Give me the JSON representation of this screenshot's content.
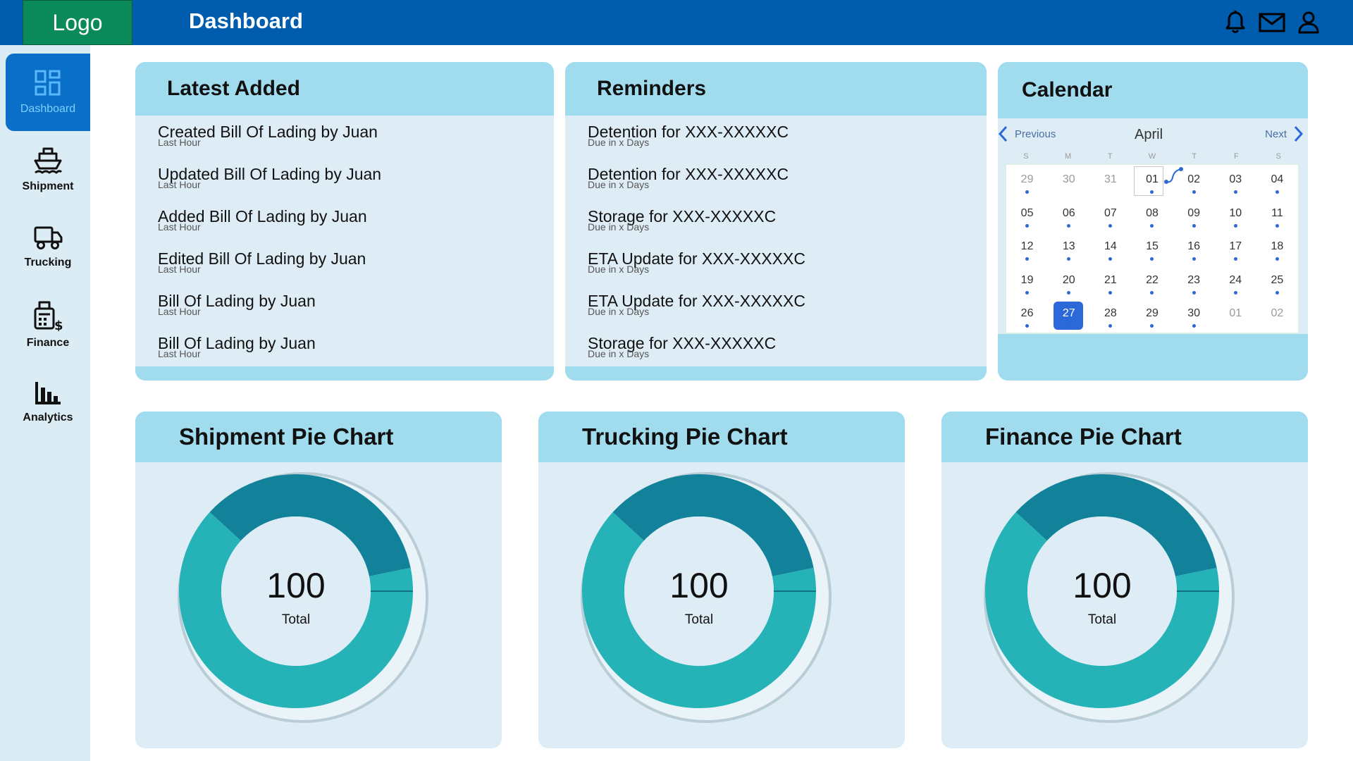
{
  "header": {
    "logo": "Logo",
    "title": "Dashboard",
    "icons": [
      "bell-icon",
      "mail-icon",
      "user-icon"
    ]
  },
  "sidebar": {
    "items": [
      {
        "label": "Dashboard",
        "icon": "dashboard-icon",
        "active": true
      },
      {
        "label": "Shipment",
        "icon": "ship-icon",
        "active": false
      },
      {
        "label": "Trucking",
        "icon": "truck-icon",
        "active": false
      },
      {
        "label": "Finance",
        "icon": "finance-icon",
        "active": false
      },
      {
        "label": "Analytics",
        "icon": "bar-chart-icon",
        "active": false
      }
    ]
  },
  "latest": {
    "title": "Latest Added",
    "items": [
      {
        "text": "Created Bill Of Lading by Juan",
        "sub": "Last Hour"
      },
      {
        "text": "Updated Bill Of Lading by Juan",
        "sub": "Last Hour"
      },
      {
        "text": "Added Bill Of Lading by Juan",
        "sub": "Last Hour"
      },
      {
        "text": "Edited Bill Of Lading by Juan",
        "sub": "Last Hour"
      },
      {
        "text": "Bill Of Lading by Juan",
        "sub": "Last Hour"
      },
      {
        "text": "Bill Of Lading by Juan",
        "sub": "Last Hour"
      }
    ]
  },
  "reminders": {
    "title": "Reminders",
    "items": [
      {
        "text": "Detention for XXX-XXXXXC",
        "sub": "Due in x Days"
      },
      {
        "text": "Detention for XXX-XXXXXC",
        "sub": "Due in x Days"
      },
      {
        "text": "Storage for XXX-XXXXXC",
        "sub": "Due in x Days"
      },
      {
        "text": "ETA Update for XXX-XXXXXC",
        "sub": "Due in x Days"
      },
      {
        "text": "ETA Update for XXX-XXXXXC",
        "sub": "Due in x Days"
      },
      {
        "text": "Storage for XXX-XXXXXC",
        "sub": "Due in x Days"
      }
    ]
  },
  "calendar": {
    "title": "Calendar",
    "prev_label": "Previous",
    "next_label": "Next",
    "month": "April",
    "weekdays": [
      "S",
      "M",
      "T",
      "W",
      "T",
      "F",
      "S"
    ],
    "days": [
      {
        "d": "29",
        "other": true,
        "dot": true
      },
      {
        "d": "30",
        "other": true,
        "dot": false
      },
      {
        "d": "31",
        "other": true,
        "dot": false
      },
      {
        "d": "01",
        "today": true,
        "dot": true
      },
      {
        "d": "02",
        "dot": true
      },
      {
        "d": "03",
        "dot": true
      },
      {
        "d": "04",
        "dot": true
      },
      {
        "d": "05",
        "dot": true
      },
      {
        "d": "06",
        "dot": true
      },
      {
        "d": "07",
        "dot": true
      },
      {
        "d": "08",
        "dot": true
      },
      {
        "d": "09",
        "dot": true
      },
      {
        "d": "10",
        "dot": true
      },
      {
        "d": "11",
        "dot": true
      },
      {
        "d": "12",
        "dot": true
      },
      {
        "d": "13",
        "dot": true
      },
      {
        "d": "14",
        "dot": true
      },
      {
        "d": "15",
        "dot": true
      },
      {
        "d": "16",
        "dot": true
      },
      {
        "d": "17",
        "dot": true
      },
      {
        "d": "18",
        "dot": true
      },
      {
        "d": "19",
        "dot": true
      },
      {
        "d": "20",
        "dot": true
      },
      {
        "d": "21",
        "dot": true
      },
      {
        "d": "22",
        "dot": true
      },
      {
        "d": "23",
        "dot": true
      },
      {
        "d": "24",
        "dot": true
      },
      {
        "d": "25",
        "dot": true
      },
      {
        "d": "26",
        "dot": true
      },
      {
        "d": "27",
        "selected": true,
        "dot": true
      },
      {
        "d": "28",
        "dot": true
      },
      {
        "d": "29",
        "dot": true
      },
      {
        "d": "30",
        "dot": true
      },
      {
        "d": "01",
        "other": true,
        "dot": false
      },
      {
        "d": "02",
        "other": true,
        "dot": false
      }
    ]
  },
  "colors": {
    "topbar": "#005cad",
    "logo_bg": "#0a8a5b",
    "card_head": "#a1dcee",
    "card_body": "#deedf5",
    "pie_dark": "#118299",
    "pie_light": "#25b3b8",
    "selected_day": "#2b68d8"
  },
  "pies": [
    {
      "title": "Shipment Pie Chart",
      "total": "100",
      "total_label": "Total"
    },
    {
      "title": "Trucking Pie Chart",
      "total": "100",
      "total_label": "Total"
    },
    {
      "title": "Finance Pie Chart",
      "total": "100",
      "total_label": "Total"
    }
  ],
  "chart_data": [
    {
      "type": "pie",
      "title": "Shipment Pie Chart",
      "values": [
        35,
        65
      ]
    },
    {
      "type": "pie",
      "title": "Trucking Pie Chart",
      "values": [
        35,
        65
      ]
    },
    {
      "type": "pie",
      "title": "Finance Pie Chart",
      "values": [
        35,
        65
      ]
    }
  ]
}
